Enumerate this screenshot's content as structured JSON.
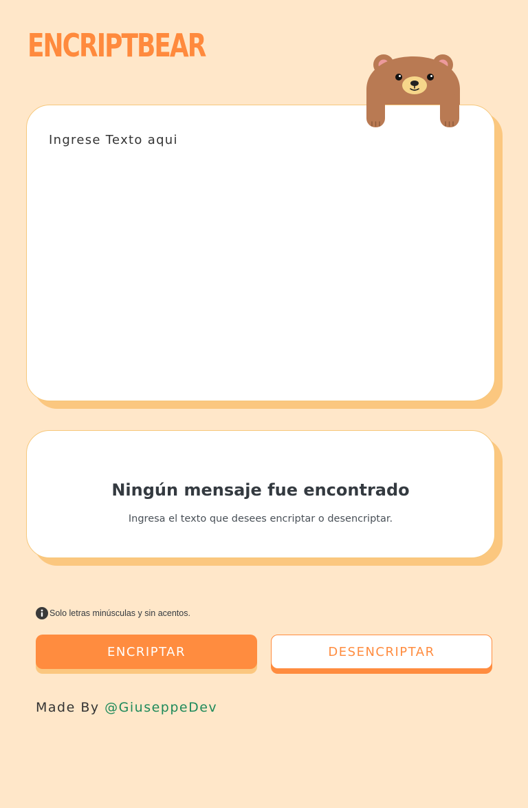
{
  "header": {
    "logo_text": "ENCRIPTBEAR",
    "mascot_icon": "bear-icon"
  },
  "input": {
    "placeholder": "Ingrese Texto aqui",
    "value": ""
  },
  "output": {
    "title": "Ningún mensaje fue encontrado",
    "subtitle": "Ingresa el texto que desees encriptar o desencriptar."
  },
  "notice": {
    "icon": "info-icon",
    "text": "Solo letras minúsculas y sin acentos."
  },
  "buttons": {
    "encrypt_label": "ENCRIPTAR",
    "decrypt_label": "DESENCRIPTAR"
  },
  "footer": {
    "prefix": "Made By ",
    "author": "@GiuseppeDev"
  },
  "colors": {
    "background": "#ffe7c9",
    "accent": "#ff8c3f",
    "card_shadow": "#fbc77f",
    "link": "#1e8a5a"
  }
}
